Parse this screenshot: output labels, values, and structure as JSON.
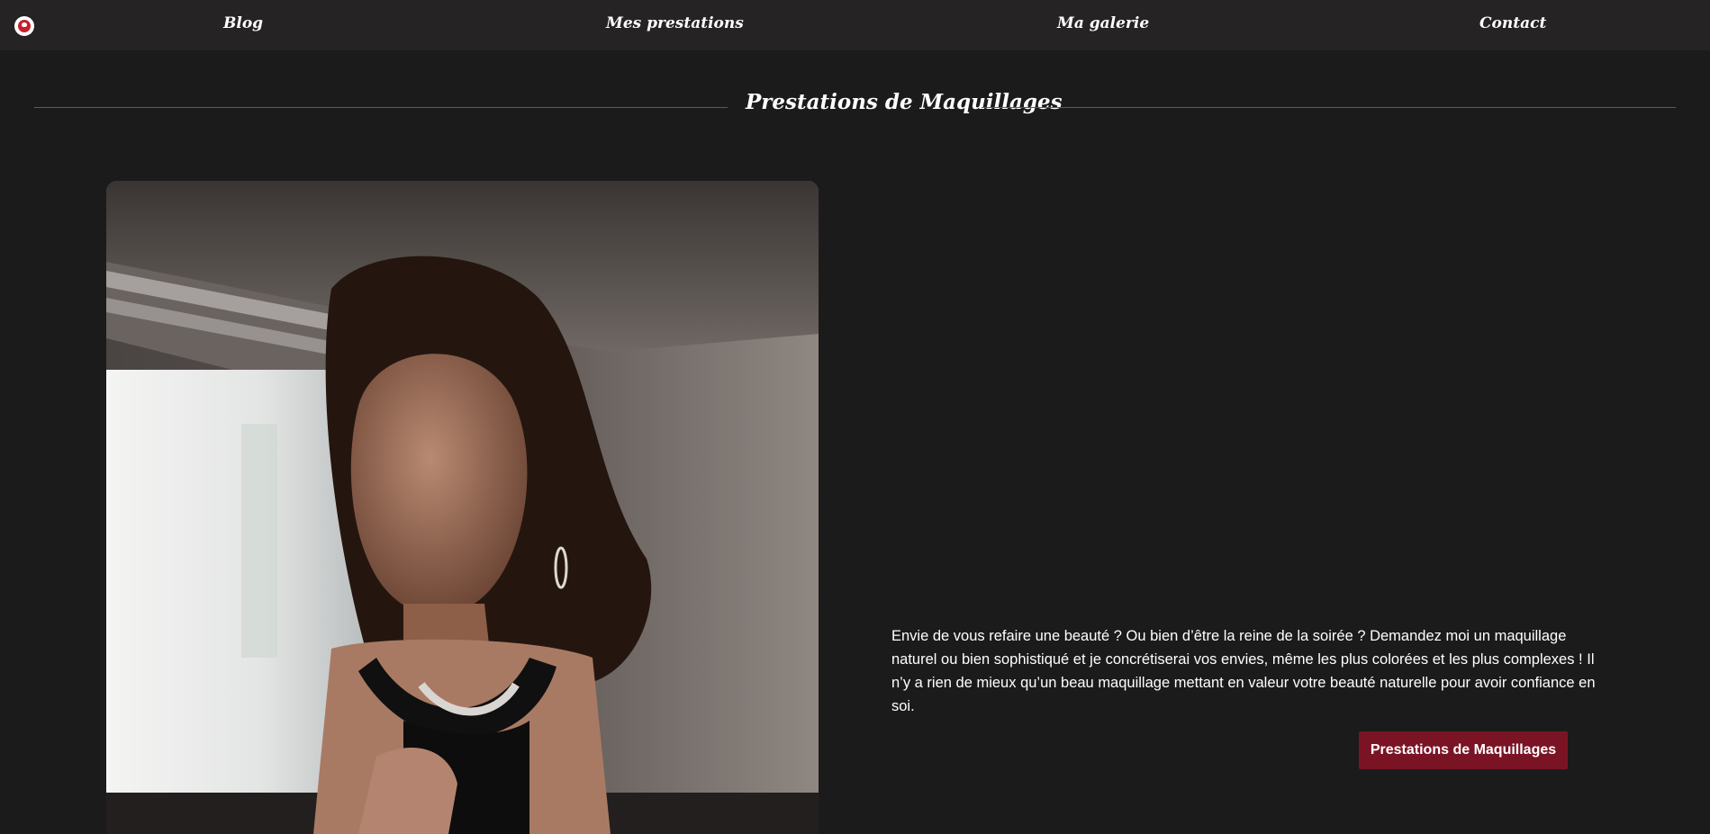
{
  "nav": {
    "logo_icon": "lipstick-logo-icon",
    "items": [
      {
        "label": "Blog"
      },
      {
        "label": "Mes prestations"
      },
      {
        "label": "Ma galerie"
      },
      {
        "label": "Contact"
      }
    ]
  },
  "section": {
    "title": "Prestations de Maquillages"
  },
  "main": {
    "image_subject": "woman-portrait-photo",
    "description": "Envie de vous refaire une beauté ? Ou bien d’être la reine de la soirée ? Demandez moi un maquillage naturel ou bien sophistiqué et je concrétiserai vos envies, même les plus colorées et les plus complexes ! Il n’y a rien de mieux qu’un beau maquillage mettant en valeur votre beauté naturelle pour avoir confiance en soi.",
    "button_label": "Prestations de Maquillages"
  },
  "colors": {
    "background": "#1b1b1c",
    "navbar": "#262324",
    "accent": "#7a1424",
    "text": "#ffffff"
  }
}
